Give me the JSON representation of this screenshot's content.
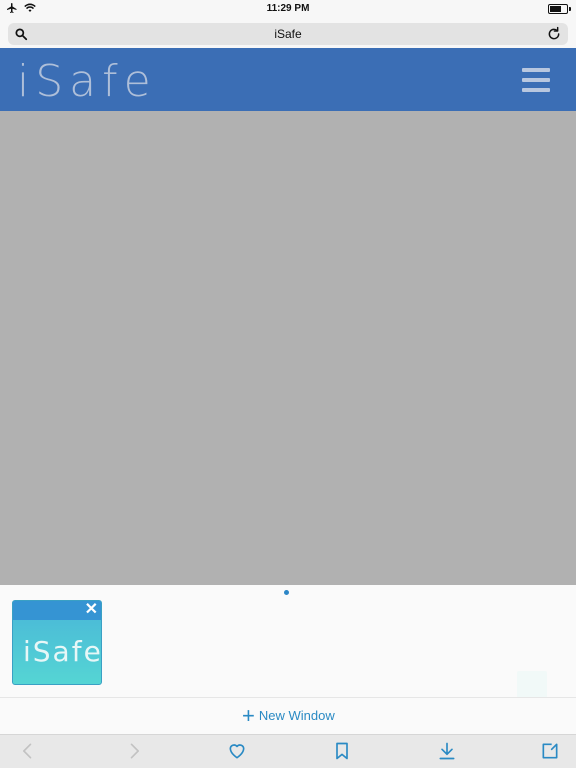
{
  "status_bar": {
    "time": "11:29 PM",
    "icons": [
      "airplane-icon",
      "wifi-icon",
      "battery-icon"
    ],
    "battery_level": 0.75
  },
  "browser": {
    "address_text": "iSafe",
    "icons": [
      "search-icon",
      "reload-icon"
    ]
  },
  "site": {
    "logo": "iSafe",
    "menu_icon": "hamburger-icon",
    "header_color": "#3b6eb5",
    "content_color": "#b1b1b1"
  },
  "tabs": {
    "items": [
      {
        "title": "iSafe",
        "close_icon": "close-icon"
      }
    ],
    "new_window_label": "New Window",
    "accent_color": "#2a8ac4"
  },
  "toolbar": {
    "icons": [
      "back-icon",
      "forward-icon",
      "heart-icon",
      "bookmark-icon",
      "download-icon",
      "share-icon"
    ]
  }
}
